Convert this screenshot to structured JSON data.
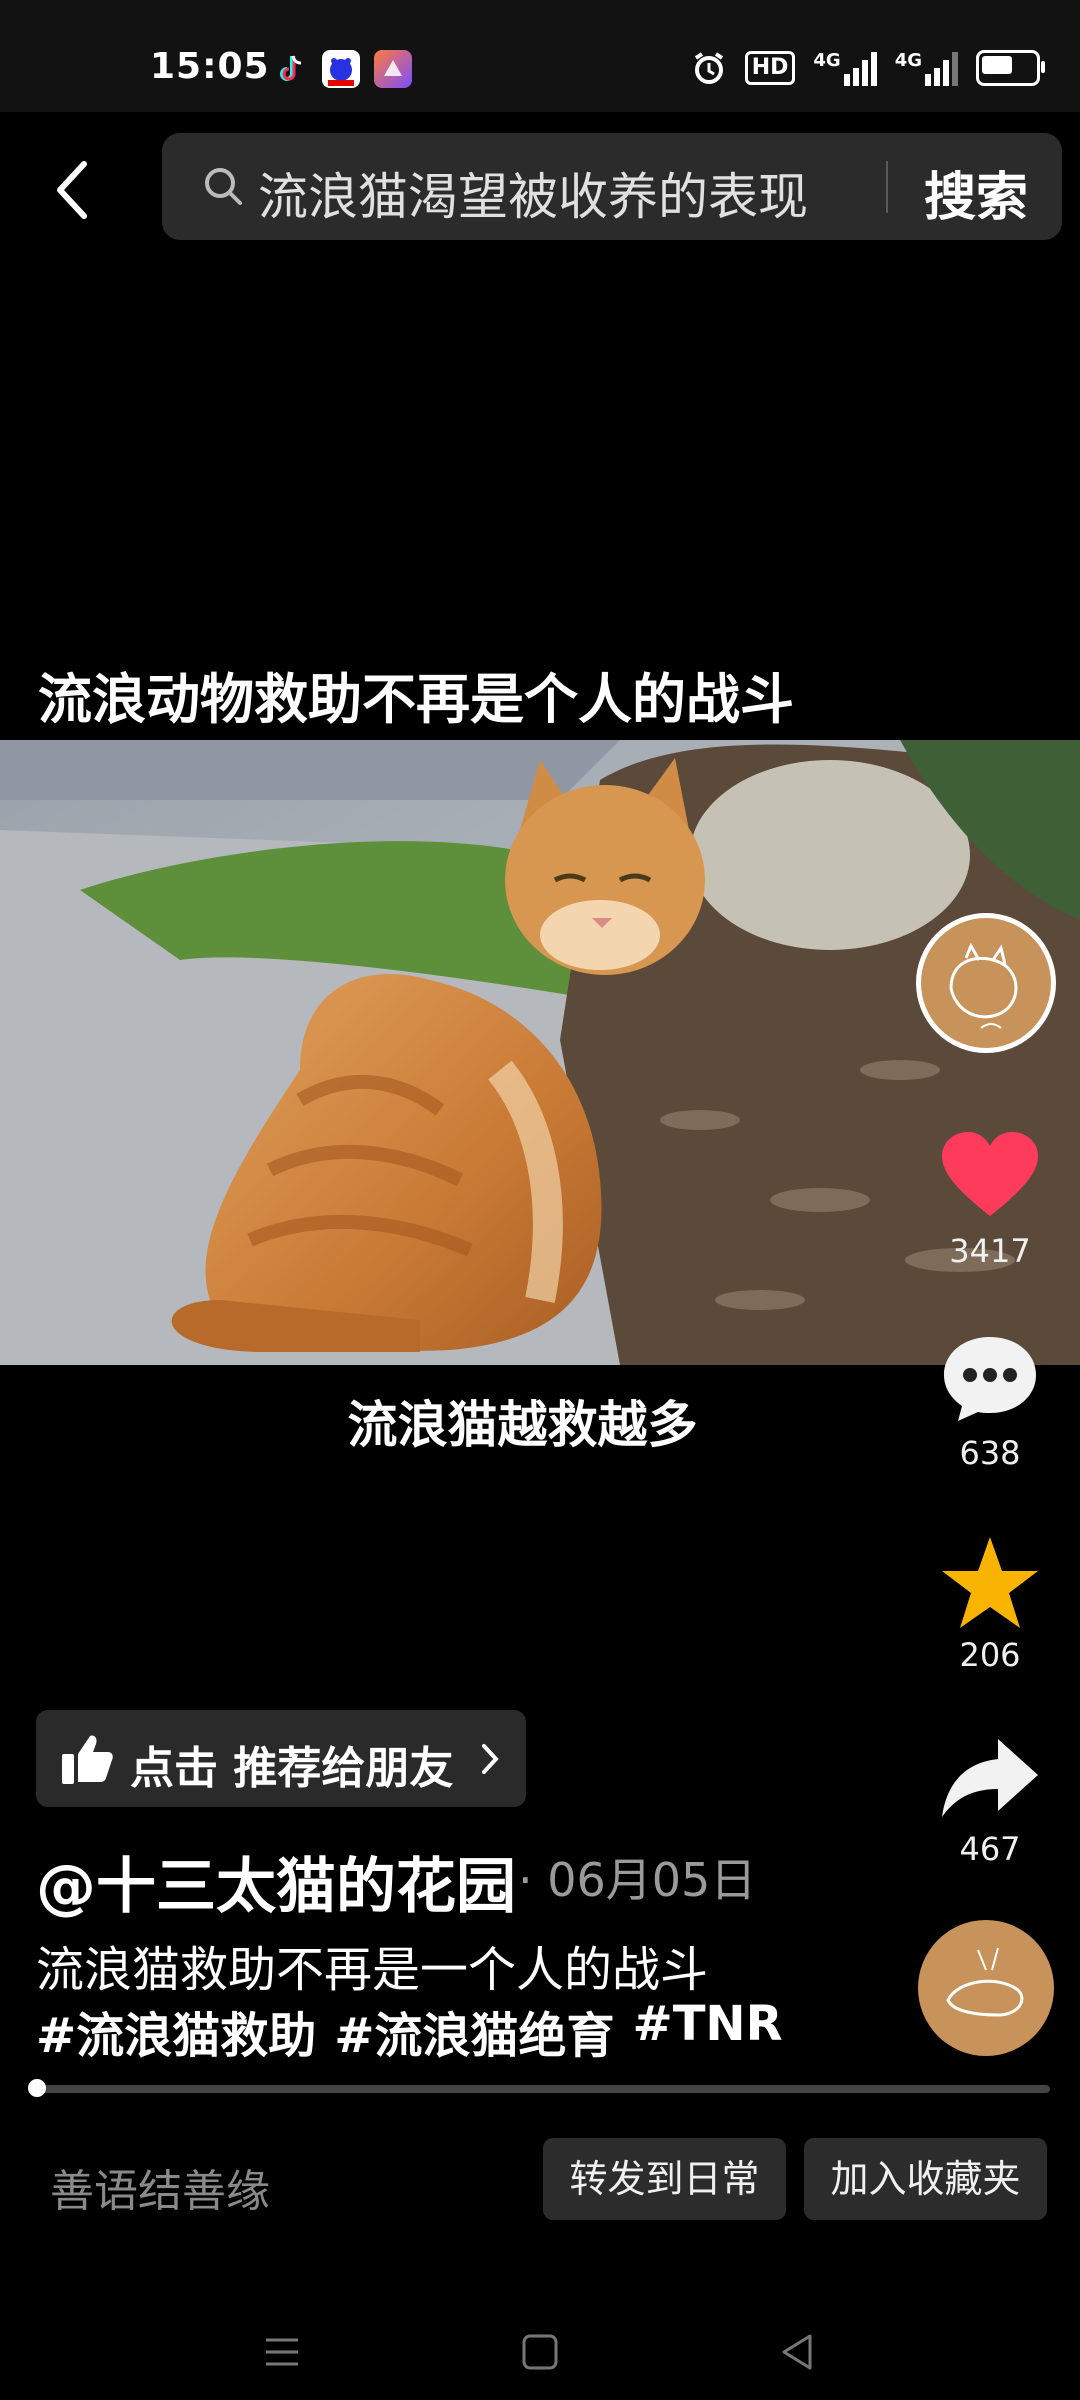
{
  "status_bar": {
    "time": "15:05",
    "hd_label": "HD",
    "network_1": "4G",
    "network_2": "4G",
    "icons": [
      "tiktok-icon",
      "baidu-icon",
      "app-icon",
      "alarm-icon",
      "hd-icon",
      "signal-icon",
      "battery-icon"
    ]
  },
  "search": {
    "query": "流浪猫渴望被收养的表现",
    "button_label": "搜索"
  },
  "video": {
    "title": "流浪动物救助不再是个人的战斗",
    "subtitle": "流浪猫越救越多"
  },
  "rail": {
    "likes": "3417",
    "comments": "638",
    "favorites": "206",
    "shares": "467",
    "like_color": "#ff3b5c",
    "star_color": "#f8b400"
  },
  "recommend": {
    "label": "点击 推荐给朋友"
  },
  "post": {
    "author": "@十三太猫的花园",
    "date": "· 06月05日",
    "description": "流浪猫救助不再是一个人的战斗",
    "tags": [
      "#流浪猫救助",
      "#流浪猫绝育",
      "#TNR"
    ]
  },
  "progress": {
    "fraction": 0.0
  },
  "bottom_bar": {
    "comment_placeholder": "善语结善缘",
    "share_daily_label": "转发到日常",
    "add_favorites_label": "加入收藏夹"
  },
  "nav": {
    "icons": [
      "menu-icon",
      "home-icon",
      "back-nav-icon"
    ]
  }
}
